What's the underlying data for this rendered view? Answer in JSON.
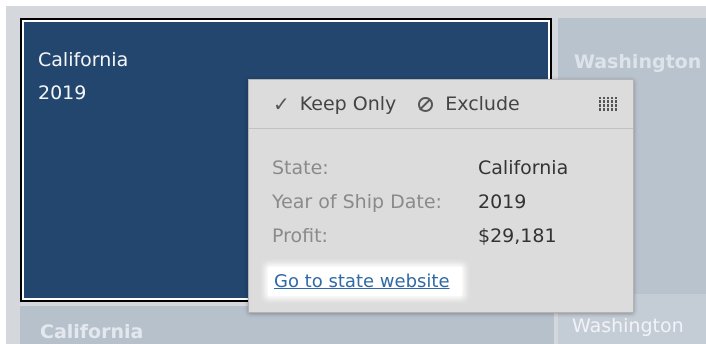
{
  "tiles": {
    "california_2019": {
      "state": "California",
      "year": "2019"
    },
    "washington_2019": {
      "state": "Washington"
    },
    "california_2020": {
      "state": "California"
    },
    "washington_2020": {
      "state": "Washington"
    }
  },
  "tooltip": {
    "actions": {
      "keep_only": {
        "icon": "checkmark-icon",
        "glyph": "✓",
        "label": "Keep Only"
      },
      "exclude": {
        "icon": "exclude-icon",
        "label": "Exclude"
      },
      "view_data": {
        "icon": "view-data-grid-icon"
      }
    },
    "fields": [
      {
        "label": "State:",
        "value": "California"
      },
      {
        "label": "Year of Ship Date:",
        "value": "2019"
      },
      {
        "label": "Profit:",
        "value": "$29,181"
      }
    ],
    "link_label": "Go to state website"
  },
  "colors": {
    "selected_tile": "#22466e",
    "faded_tile": "#b9c3ce",
    "tooltip_bg": "#dcdcdc",
    "link": "#2f6aa6"
  }
}
